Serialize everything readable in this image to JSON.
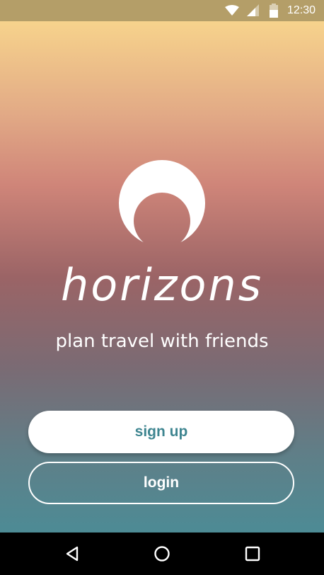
{
  "status_bar": {
    "time": "12:30",
    "icons": [
      "wifi-icon",
      "signal-icon",
      "battery-icon"
    ]
  },
  "app": {
    "logo_icon": "horizon-logo-icon",
    "name": "horizons",
    "tagline": "plan travel with friends"
  },
  "actions": {
    "signup_label": "sign up",
    "login_label": "login"
  },
  "nav_bar": {
    "icons": [
      "back-icon",
      "home-icon",
      "recents-icon"
    ]
  },
  "colors": {
    "status_bar": "#b49e68",
    "gradient_top": "#f7d38c",
    "gradient_mid": "#9b6466",
    "gradient_bottom": "#4d8b95",
    "accent": "#3e8590",
    "nav_bar": "#000000"
  }
}
